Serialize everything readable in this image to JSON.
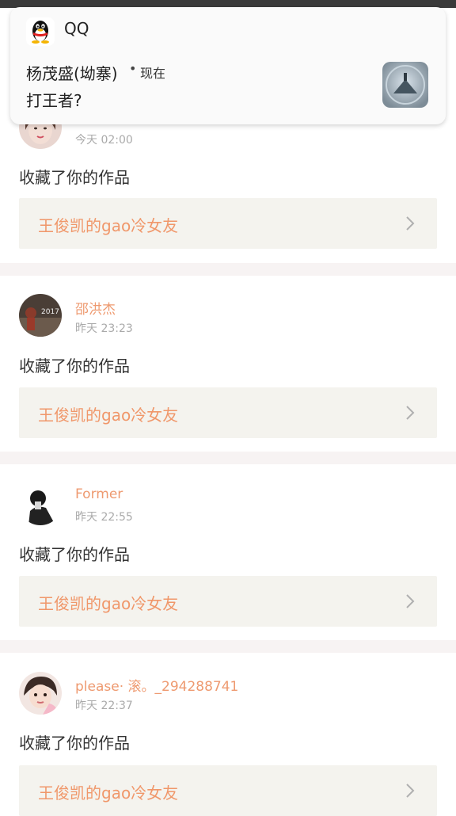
{
  "notification": {
    "app_name": "QQ",
    "sender": "杨茂盛(坳寨)",
    "separator": "•",
    "time": "现在",
    "message": "打王者?"
  },
  "items": [
    {
      "user": "",
      "time": "今天 02:00",
      "action": "收藏了你的作品",
      "work_title": "王俊凯的gao冷女友"
    },
    {
      "user": "邵洪杰",
      "time": "昨天 23:23",
      "action": "收藏了你的作品",
      "work_title": "王俊凯的gao冷女友",
      "avatar_text": "2017 OP"
    },
    {
      "user": "Former",
      "time": "昨天 22:55",
      "action": "收藏了你的作品",
      "work_title": "王俊凯的gao冷女友"
    },
    {
      "user": "please· 滚。_294288741",
      "time": "昨天 22:37",
      "action": "收藏了你的作品",
      "work_title": "王俊凯的gao冷女友"
    }
  ],
  "colors": {
    "username": "#ee9a70",
    "card_title": "#f0976a",
    "card_bg": "#f4f3ee",
    "divider": "#f7f3f3"
  },
  "icons": {
    "notification_app": "qq-penguin-icon",
    "card_arrow": "chevron-right-icon"
  }
}
